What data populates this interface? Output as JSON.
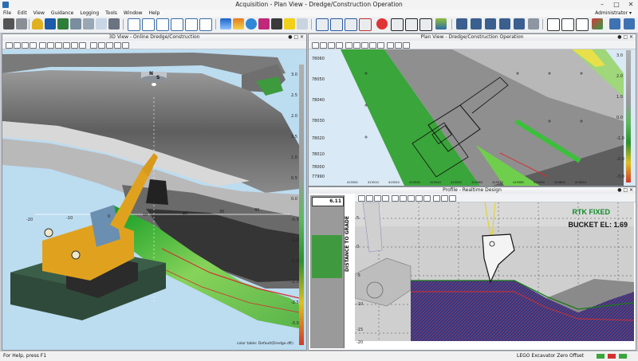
{
  "window": {
    "title": "Acquisition - Plan View - Dredge/Construction Operation",
    "user": "Administrator"
  },
  "menu": [
    "File",
    "Edit",
    "View",
    "Guidance",
    "Logging",
    "Tools",
    "Window",
    "Help"
  ],
  "toolbar": {
    "icon_names": [
      "camera-icon",
      "video-icon",
      "bell-icon",
      "phone-icon",
      "panel-icon",
      "window-icon",
      "hdd-icon",
      "caliper-icon",
      "usb-icon",
      "window-icon",
      "window-icon",
      "window-icon",
      "window-icon",
      "weather-icon",
      "chart-icon",
      "globe-icon",
      "gem-icon",
      "dredge-icon",
      "warning-icon",
      "align-icon",
      "align-icon",
      "cut-icon",
      "pick-icon",
      "vector-icon",
      "marker-icon",
      "lifebuoy-icon",
      "crosshair-icon",
      "crosshair-icon",
      "crosshair-icon",
      "image-icon",
      "save-icon",
      "save-icon",
      "save-icon",
      "save-icon",
      "save-icon",
      "list-icon",
      "plus-icon",
      "triangle-icon",
      "layout-icon",
      "layout-icon"
    ]
  },
  "view3d": {
    "title": "3D View - Online Dredge/Construction",
    "compass_n": "N",
    "compass_s": "S",
    "axis_labels": [
      "-20",
      "-10",
      "0",
      "10",
      "20",
      "30",
      "40"
    ],
    "scale_labels": [
      "3.0",
      "2.5",
      "2.0",
      "1.5",
      "1.0",
      "0.5",
      "0.0",
      "-0.5",
      "-1.0",
      "-1.5",
      "-2.0",
      "-2.5",
      "-3.0"
    ],
    "color_table": "color table: Default(Dredge.dft)"
  },
  "planview": {
    "title": "Plan View - Dredge/Construction Operation",
    "y_labels": [
      "78060",
      "78050",
      "78040",
      "78030",
      "78020",
      "78010",
      "78000",
      "77990"
    ],
    "x_labels": [
      "415500",
      "415510",
      "415520",
      "415530",
      "415540",
      "415550",
      "415560",
      "415570",
      "415580",
      "415590",
      "415600",
      "415610"
    ],
    "scale_labels": [
      "3.0",
      "2.5",
      "2.0",
      "1.5",
      "1.0",
      "0.5",
      "0.0",
      "-0.5",
      "-1.0",
      "-1.5",
      "-2.0",
      "-2.5",
      "-3.0"
    ]
  },
  "profile": {
    "title": "Profile - Realtime Design",
    "distance_value": "6.11",
    "distance_label": "DISTANCE TO GRADE",
    "rtk_status": "RTK FIXED",
    "bucket_elevation": "BUCKET EL: 1.69",
    "y_labels": [
      "5",
      "0",
      "-5",
      "-10",
      "-15",
      "-20"
    ]
  },
  "status": {
    "help": "For Help, press F1",
    "machine": "LEGO Excavator Zero Offset"
  },
  "colors": {
    "green_text": "#0f8a2a",
    "design_line": "#1a7a1a",
    "sediment": "#2f3a86",
    "bar_green": "#3f9a3f"
  }
}
